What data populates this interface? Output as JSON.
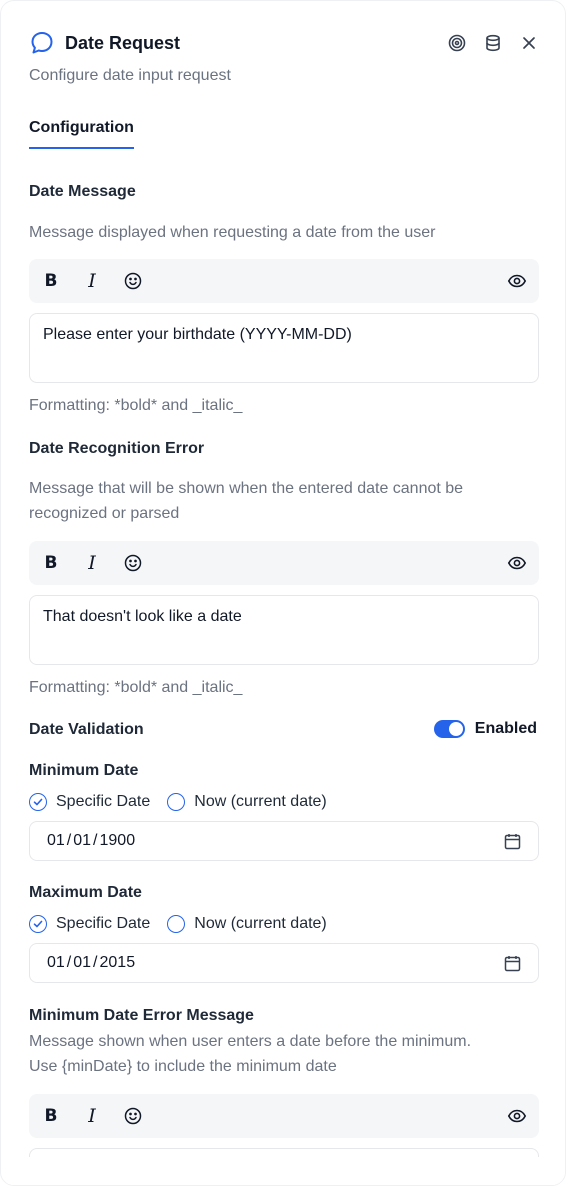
{
  "header": {
    "title": "Date Request",
    "subtitle": "Configure date input request",
    "icons": [
      "chat-bubble-icon",
      "target-icon",
      "database-icon",
      "close-icon"
    ]
  },
  "tabs": [
    {
      "label": "Configuration",
      "active": true
    }
  ],
  "date_message": {
    "label": "Date Message",
    "description": "Message displayed when requesting a date from the user",
    "value": "Please enter your birthdate (YYYY-MM-DD)",
    "hint": "Formatting: *bold* and _italic_"
  },
  "recognition_error": {
    "label": "Date Recognition Error",
    "description_line1": "Message that will be shown when the entered date cannot be",
    "description_line2": "recognized or parsed",
    "value": "That doesn't look like a date",
    "hint": "Formatting: *bold* and _italic_"
  },
  "toolbar": {
    "bold_label": "B",
    "italic_label": "I"
  },
  "validation": {
    "label": "Date Validation",
    "toggle_label": "Enabled",
    "enabled": true
  },
  "min_date": {
    "label": "Minimum Date",
    "option_specific": "Specific Date",
    "option_now": "Now (current date)",
    "selected": "Specific Date",
    "month": "01",
    "day": "01",
    "year": "1900"
  },
  "max_date": {
    "label": "Maximum Date",
    "option_specific": "Specific Date",
    "option_now": "Now (current date)",
    "selected": "Specific Date",
    "month": "01",
    "day": "01",
    "year": "2015"
  },
  "min_error": {
    "label": "Minimum Date Error Message",
    "description_line1": "Message shown when user enters a date before the minimum.",
    "description_line2": "Use {minDate} to include the minimum date"
  },
  "colors": {
    "accent": "#2563eb",
    "muted_text": "#6b7280",
    "toolbar_bg": "#f5f6f8"
  }
}
